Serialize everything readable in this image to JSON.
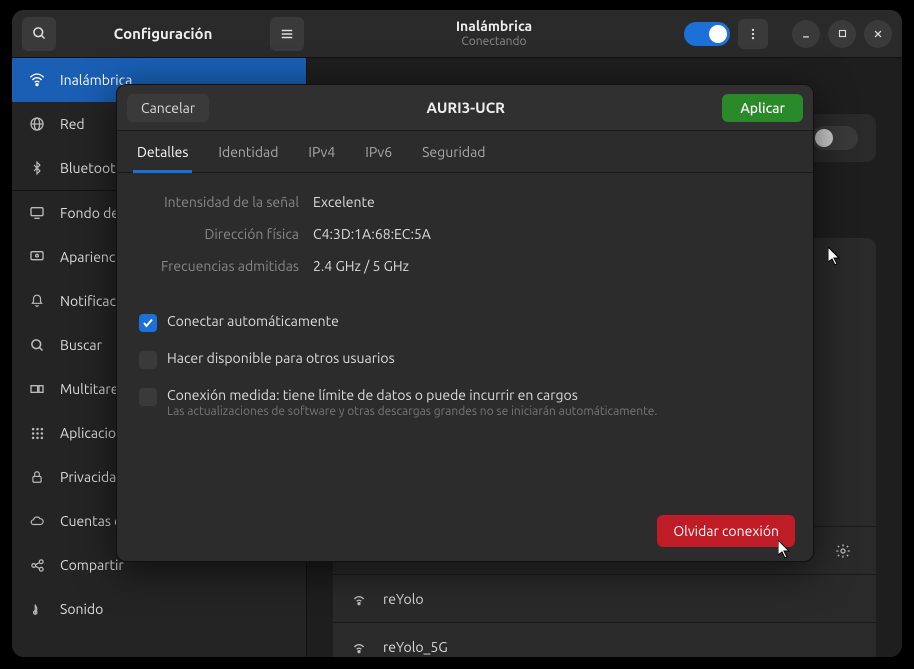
{
  "titlebar": {
    "app_title": "Configuración",
    "page_title": "Inalámbrica",
    "page_subtitle": "Conectando"
  },
  "sidebar": {
    "items": [
      {
        "label": "Inalámbrica",
        "active": true
      },
      {
        "label": "Red"
      },
      {
        "label": "Bluetooth"
      },
      {
        "sep": true
      },
      {
        "label": "Fondo de escritorio"
      },
      {
        "label": "Apariencia"
      },
      {
        "label": "Notificaciones"
      },
      {
        "label": "Buscar"
      },
      {
        "label": "Multitarea"
      },
      {
        "label": "Aplicaciones"
      },
      {
        "label": "Privacidad"
      },
      {
        "label": "Cuentas en línea"
      },
      {
        "label": "Compartir"
      },
      {
        "label": "Sonido"
      }
    ]
  },
  "networks": [
    {
      "name": "AURI3-UCR"
    },
    {
      "name": "reYolo"
    },
    {
      "name": "reYolo_5G"
    }
  ],
  "modal": {
    "cancel": "Cancelar",
    "title": "AURI3-UCR",
    "apply": "Aplicar",
    "tabs": [
      "Detalles",
      "Identidad",
      "IPv4",
      "IPv6",
      "Seguridad"
    ],
    "details": {
      "signal_label": "Intensidad de la señal",
      "signal_value": "Excelente",
      "mac_label": "Dirección física",
      "mac_value": "C4:3D:1A:68:EC:5A",
      "freq_label": "Frecuencias admitidas",
      "freq_value": "2.4 GHz / 5 GHz"
    },
    "checks": {
      "auto": "Conectar automáticamente",
      "share": "Hacer disponible para otros usuarios",
      "metered": "Conexión medida: tiene límite de datos o puede incurrir en cargos",
      "metered_sub": "Las actualizaciones de software y otras descargas grandes no se iniciarán automáticamente."
    },
    "forget": "Olvidar conexión"
  }
}
